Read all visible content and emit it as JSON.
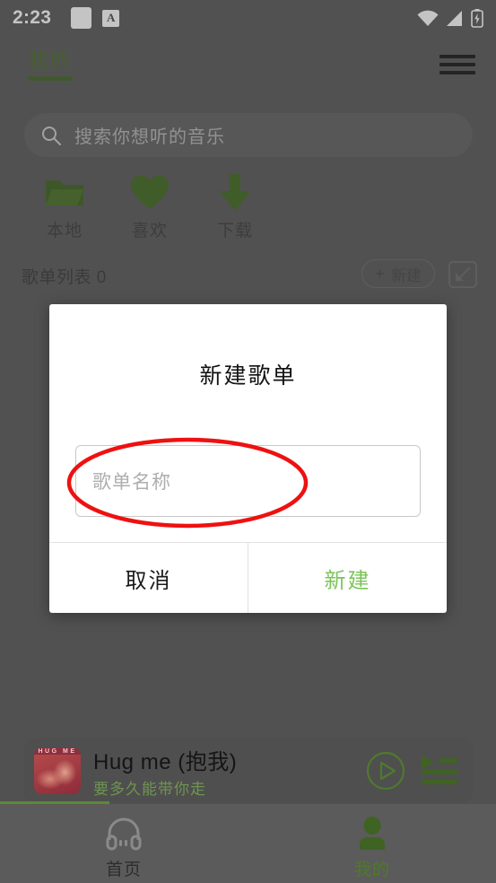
{
  "status_bar": {
    "time": "2:23",
    "icons": [
      "notification-square-icon",
      "app-badge-a-icon",
      "wifi-icon",
      "cellular-signal-icon",
      "battery-charging-icon"
    ],
    "badge_letter": "A"
  },
  "top_bar": {
    "active_tab": "我的",
    "menu_icon": "hamburger-menu-icon"
  },
  "search": {
    "placeholder": "搜索你想听的音乐",
    "icon": "search-icon"
  },
  "quick_actions": [
    {
      "label": "本地",
      "icon": "folder-icon"
    },
    {
      "label": "喜欢",
      "icon": "heart-icon"
    },
    {
      "label": "下载",
      "icon": "download-arrow-icon"
    }
  ],
  "playlist_section": {
    "title": "歌单列表 0",
    "new_button_label": "新建",
    "new_button_plus": "+",
    "import_icon": "import-arrow-icon"
  },
  "dialog": {
    "title": "新建歌单",
    "input_placeholder": "歌单名称",
    "input_value": "",
    "cancel_label": "取消",
    "confirm_label": "新建",
    "confirm_color": "#7cc45a"
  },
  "annotation": {
    "shape": "ellipse",
    "color": "#ee1111",
    "target": "playlist-name-input"
  },
  "mini_player": {
    "title": "Hug me (抱我)",
    "subtitle": "要多久能带你走",
    "album_art_text": "HUG ME",
    "play_icon": "play-circle-icon",
    "queue_icon": "playlist-queue-icon"
  },
  "bottom_nav": [
    {
      "label": "首页",
      "icon": "headphones-icon",
      "active": false
    },
    {
      "label": "我的",
      "icon": "person-icon",
      "active": true
    }
  ],
  "theme": {
    "accent_green": "#4b7027",
    "scrim": "#5b5b5b",
    "dialog_bg": "#ffffff"
  }
}
